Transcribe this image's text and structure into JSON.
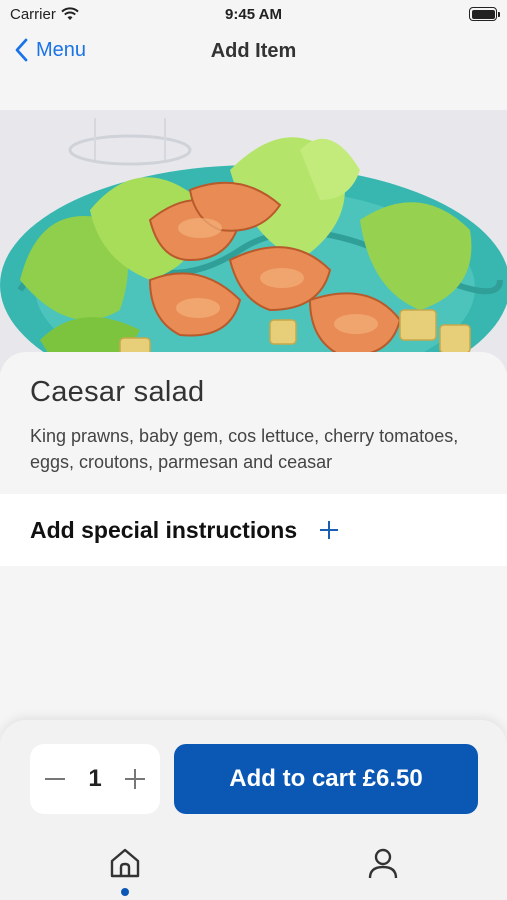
{
  "status_bar": {
    "carrier": "Carrier",
    "time": "9:45 AM"
  },
  "nav": {
    "back_label": "Menu",
    "title": "Add Item"
  },
  "item": {
    "name": "Caesar salad",
    "description": "King prawns, baby gem, cos lettuce, cherry tomatoes, eggs, croutons, parmesan and ceasar",
    "image": "caesar-salad-photo"
  },
  "instructions": {
    "label": "Add special instructions",
    "icon": "plus-icon"
  },
  "cart": {
    "quantity": "1",
    "button_label": "Add to cart £6.50"
  },
  "tab_bar": {
    "items": [
      {
        "name": "home",
        "icon": "home-icon",
        "active": true
      },
      {
        "name": "profile",
        "icon": "person-icon",
        "active": false
      }
    ]
  },
  "colors": {
    "accent": "#0b57b4",
    "link": "#1a73e8",
    "background": "#f5f5f5"
  }
}
